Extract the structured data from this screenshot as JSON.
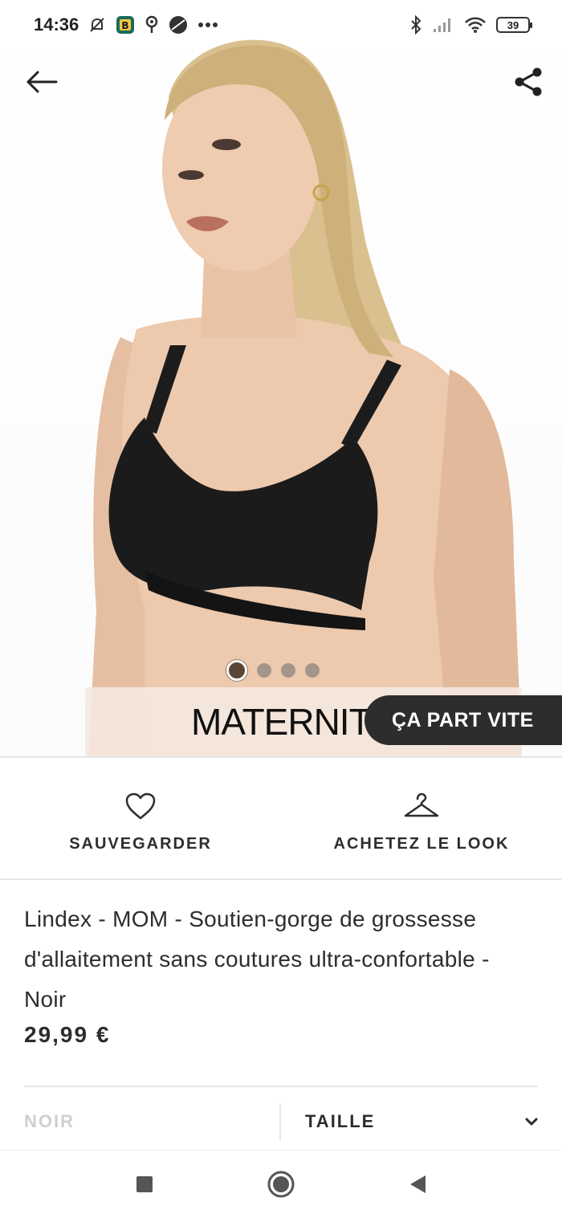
{
  "status_bar": {
    "time": "14:36",
    "notification_icons": [
      "muted-bell-icon",
      "b-app-icon",
      "location-icon",
      "circle-app-icon",
      "more-dots-icon"
    ],
    "battery": "39",
    "system_icons": [
      "bluetooth-icon",
      "signal-icon",
      "wifi-icon",
      "battery-icon"
    ]
  },
  "hero": {
    "overlay_text": "MATERNITY",
    "badge": "ÇA PART VITE",
    "carousel": {
      "count": 4,
      "active_index": 0
    }
  },
  "actions": {
    "save_label": "SAUVEGARDER",
    "shop_look_label": "ACHETEZ LE LOOK"
  },
  "product": {
    "title": "Lindex - MOM - Soutien-gorge de grossesse d'allaitement sans coutures ultra-confortable - Noir",
    "price": "29,99 €",
    "color_label": "NOIR",
    "size_label": "TAILLE"
  },
  "colors": {
    "text": "#2d2d2d",
    "badge_bg": "#2d2d2d",
    "maternity_band": "#f6e9e1",
    "active_dot": "#5a4636",
    "inactive_dot": "#a3958c"
  }
}
